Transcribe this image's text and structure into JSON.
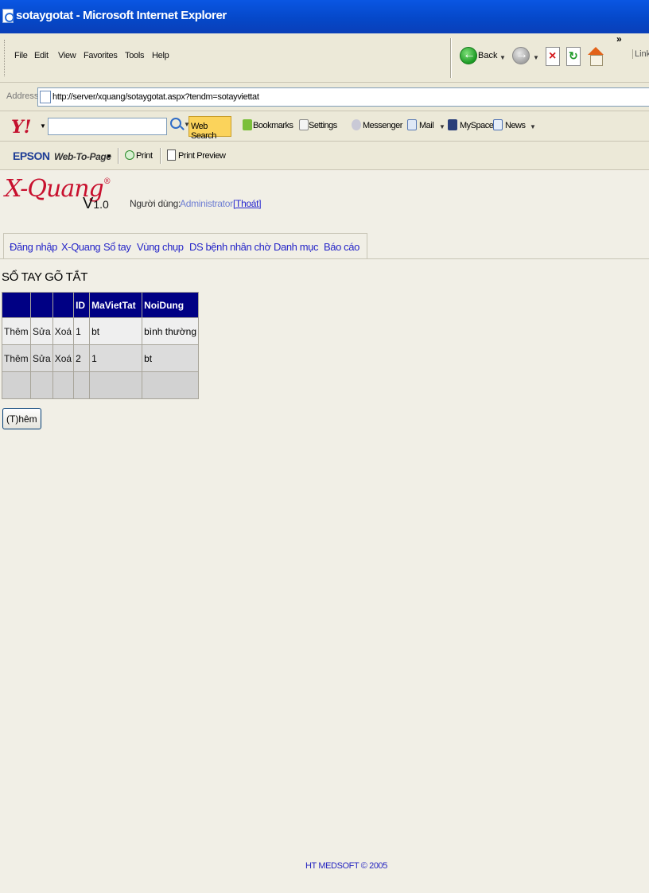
{
  "window": {
    "title": "sotaygotat - Microsoft Internet Explorer"
  },
  "menu": {
    "items": [
      "File",
      "Edit",
      "View",
      "Favorites",
      "Tools",
      "Help"
    ]
  },
  "nav_toolbar": {
    "back_label": "Back",
    "chevrons": "»",
    "links_label": "Links"
  },
  "address": {
    "label": "Address",
    "url": "http://server/xquang/sotaygotat.aspx?tendm=sotayviettat"
  },
  "yahoo_toolbar": {
    "logo": "Y!",
    "search_value": "",
    "web_search": "Web Search",
    "items": [
      "Bookmarks",
      "Settings",
      "Messenger",
      "Mail",
      "MySpace",
      "News"
    ]
  },
  "epson_toolbar": {
    "brand": "EPSON",
    "web_to_page": "Web-To-Page",
    "print": "Print",
    "print_preview": "Print Preview"
  },
  "header": {
    "logo_text": "X-Quang",
    "logo_mark": "®",
    "version_prefix": "V",
    "version_number": "1.0",
    "user_label": "Người dùng:",
    "user_name": "Administrator",
    "logout": "[Thoát]"
  },
  "nav": {
    "tabs": [
      "Đăng nhập",
      "X-Quang",
      "Sổ tay",
      "Vùng chụp",
      "DS bệnh nhân chờ",
      "Danh mục",
      "Báo cáo"
    ]
  },
  "page": {
    "title": "SỔ TAY GÕ TẮT"
  },
  "table": {
    "headers": [
      "",
      "",
      "",
      "ID",
      "MaVietTat",
      "NoiDung"
    ],
    "rows": [
      {
        "add": "Thêm",
        "edit": "Sửa",
        "delete": "Xoá",
        "id": "1",
        "code": "bt",
        "content": "bình thường"
      },
      {
        "add": "Thêm",
        "edit": "Sửa",
        "delete": "Xoá",
        "id": "2",
        "code": "1",
        "content": "bt"
      }
    ]
  },
  "buttons": {
    "add": "(T)hêm"
  },
  "footer": {
    "text": "HT MEDSOFT © 2005"
  }
}
